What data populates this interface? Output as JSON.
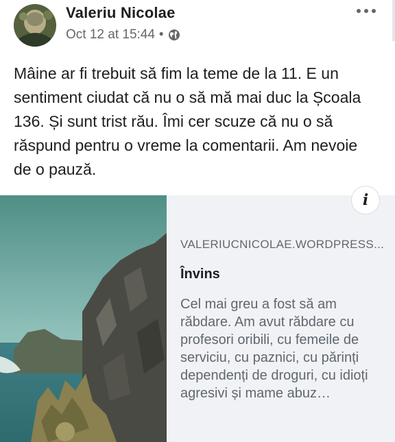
{
  "post": {
    "author": "Valeriu Nicolae",
    "timestamp": "Oct 12 at 15:44",
    "separator": "•",
    "privacy_icon": "globe-icon",
    "more_icon": "more-options-icon",
    "text": "Mâine ar fi trebuit să fim la teme de la 11. E un sentiment ciudat că nu o să mă mai duc la Școala 136. Și sunt trist rău. Îmi cer scuze că nu o să răspund pentru o vreme la comentarii. Am nevoie de o pauză."
  },
  "link_preview": {
    "info_label": "i",
    "domain": "VALERIUCNICOLAE.WORDPRESS...",
    "title": "Învins",
    "description": "Cel mai greu a fost să am răbdare. Am avut răbdare cu profesori oribili, cu femeile de serviciu, cu paznici, cu părinți dependenți de droguri, cu idioți agresivi și mame abuz…",
    "image_subject": "coastal cliff with sea"
  },
  "colors": {
    "text_primary": "#1c1e21",
    "text_secondary": "#65676b",
    "card_background": "#f0f2f5"
  }
}
